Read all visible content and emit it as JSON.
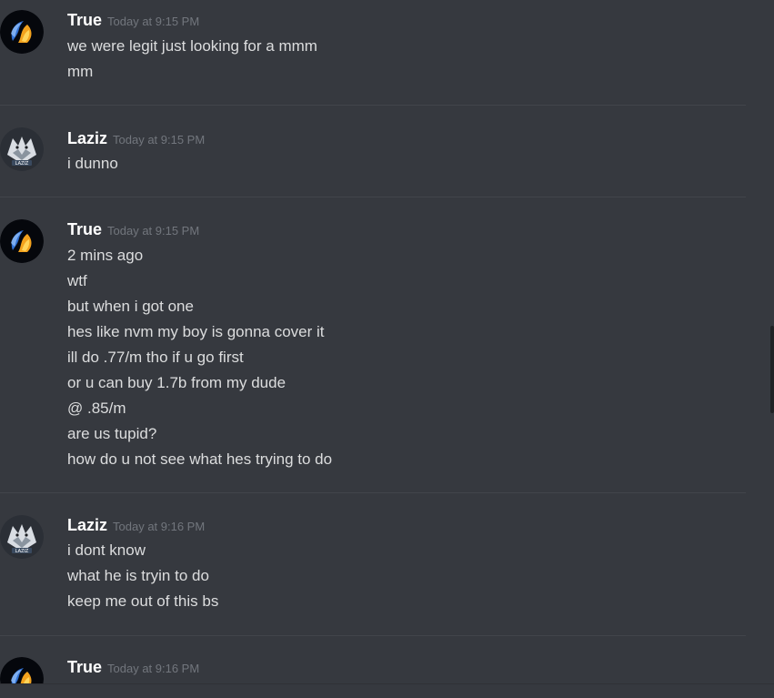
{
  "messages": [
    {
      "author": "True",
      "timestamp": "Today at 9:15 PM",
      "avatar_icon": "blue-orange-flame-avatar",
      "lines": [
        "we were legit just looking for a mmm",
        "mm"
      ]
    },
    {
      "author": "Laziz",
      "timestamp": "Today at 9:15 PM",
      "avatar_icon": "wolf-emblem-avatar",
      "lines": [
        "i dunno"
      ]
    },
    {
      "author": "True",
      "timestamp": "Today at 9:15 PM",
      "avatar_icon": "blue-orange-flame-avatar",
      "lines": [
        "2 mins ago",
        "wtf",
        "but when i got one",
        "hes like nvm my boy is gonna cover it",
        "ill do .77/m tho if u go first",
        "or u can buy 1.7b from my dude",
        "@ .85/m",
        "are us tupid?",
        "how do u not see what hes trying to do"
      ]
    },
    {
      "author": "Laziz",
      "timestamp": "Today at 9:16 PM",
      "avatar_icon": "wolf-emblem-avatar",
      "lines": [
        "i dont know",
        "what he is tryin to do",
        "keep me out of this bs"
      ]
    },
    {
      "author": "True",
      "timestamp": "Today at 9:16 PM",
      "avatar_icon": "blue-orange-flame-avatar",
      "lines": []
    }
  ],
  "colors": {
    "background": "#36393f",
    "username": "#ffffff",
    "timestamp": "#72767d",
    "message_text": "#dcddde",
    "divider": "#42454b"
  }
}
